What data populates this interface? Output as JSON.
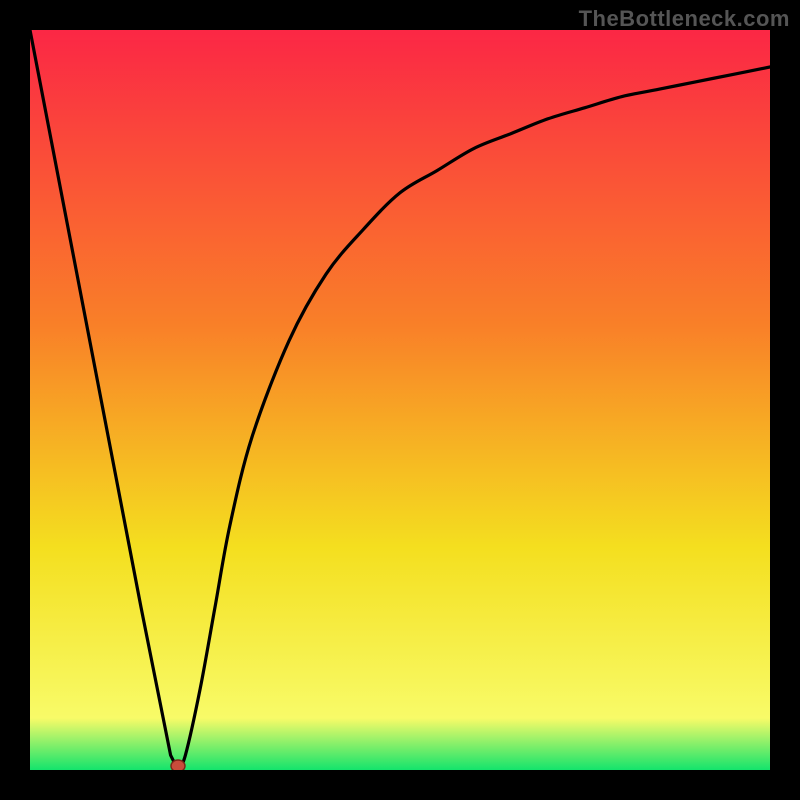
{
  "watermark": "TheBottleneck.com",
  "colors": {
    "frame_background": "#000000",
    "gradient_top": "#fb2745",
    "gradient_mid1": "#f98028",
    "gradient_mid2": "#f4df1f",
    "gradient_mid3": "#f8fb68",
    "gradient_bottom": "#14e46c",
    "curve": "#000000",
    "marker_fill": "#c84c3b",
    "marker_stroke": "#7a2618"
  },
  "chart_data": {
    "type": "line",
    "title": "",
    "xlabel": "",
    "ylabel": "",
    "xlim": [
      0,
      100
    ],
    "ylim": [
      0,
      100
    ],
    "series": [
      {
        "name": "bottleneck-curve",
        "x": [
          0,
          5,
          10,
          15,
          19,
          20,
          21,
          23,
          25,
          27,
          30,
          35,
          40,
          45,
          50,
          55,
          60,
          65,
          70,
          75,
          80,
          85,
          90,
          95,
          100
        ],
        "y": [
          100,
          74,
          48,
          22,
          2,
          0,
          2,
          11,
          22,
          33,
          45,
          58,
          67,
          73,
          78,
          81,
          84,
          86,
          88,
          89.5,
          91,
          92,
          93,
          94,
          95
        ]
      }
    ],
    "marker": {
      "x": 20,
      "y": 0
    },
    "gradient_stops": [
      {
        "offset": 0.0,
        "color_key": "gradient_top"
      },
      {
        "offset": 0.4,
        "color_key": "gradient_mid1"
      },
      {
        "offset": 0.7,
        "color_key": "gradient_mid2"
      },
      {
        "offset": 0.93,
        "color_key": "gradient_mid3"
      },
      {
        "offset": 1.0,
        "color_key": "gradient_bottom"
      }
    ]
  }
}
